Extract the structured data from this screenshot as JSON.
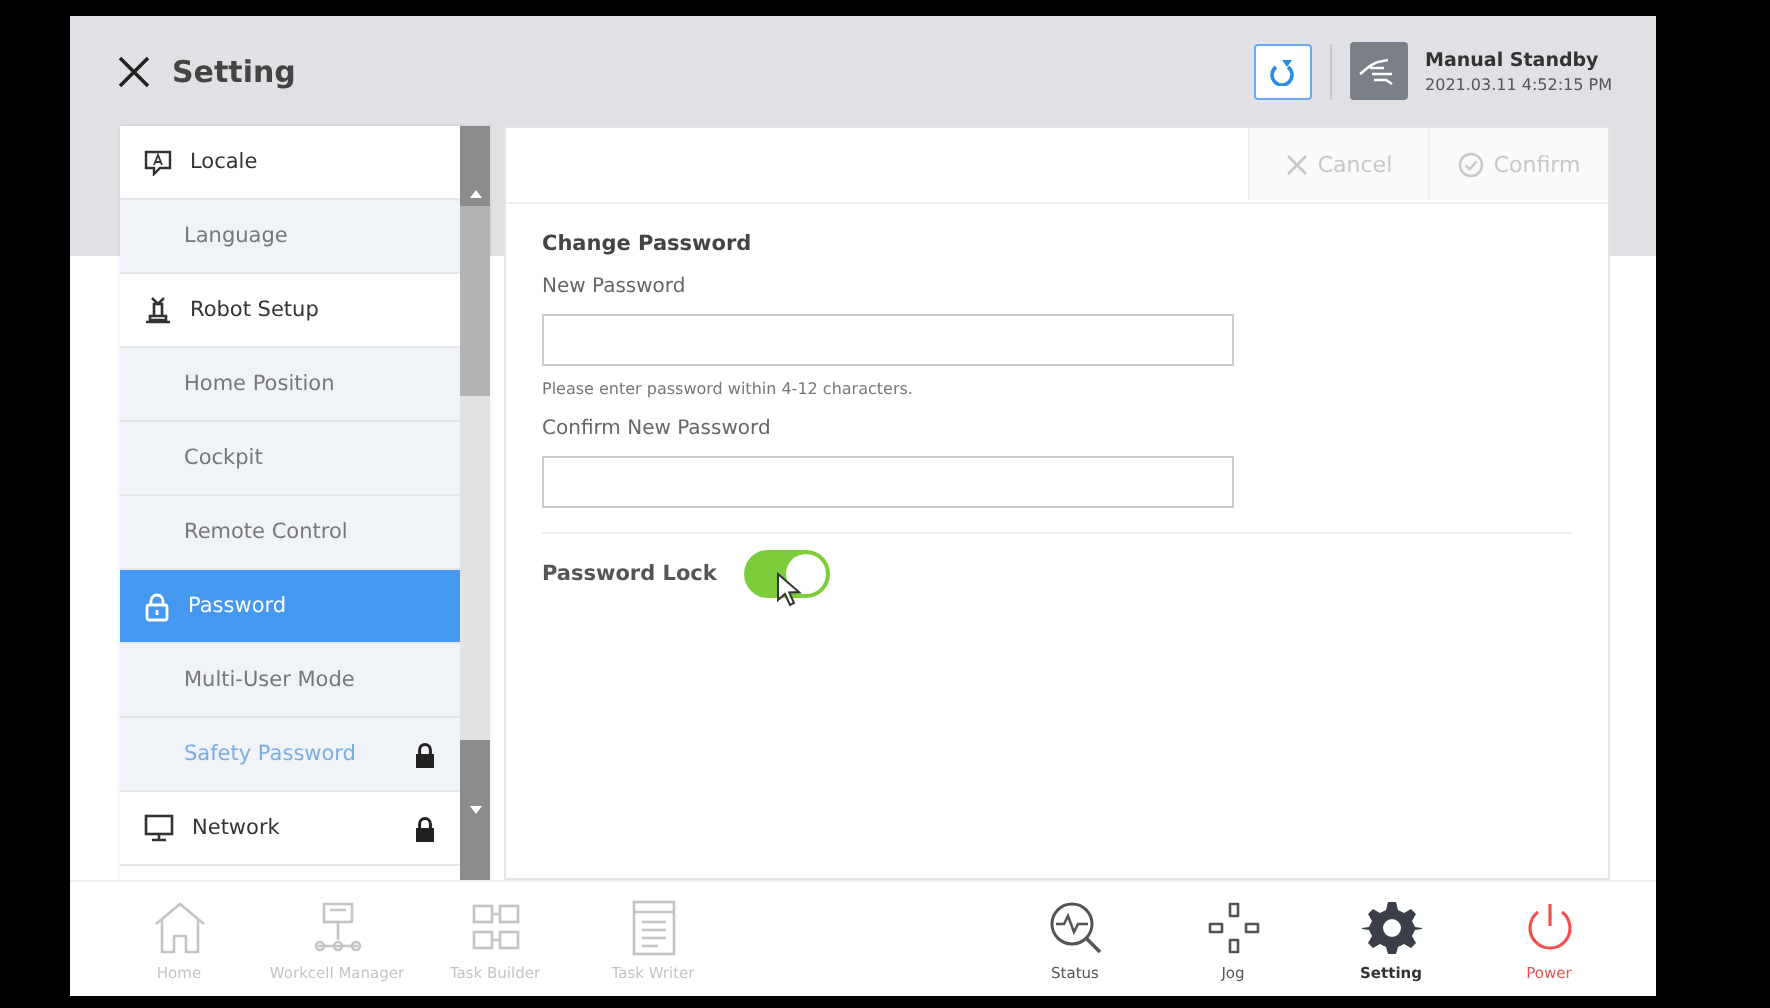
{
  "header": {
    "title": "Setting",
    "mode": "Manual Standby",
    "datetime": "2021.03.11 4:52:15 PM"
  },
  "sidebar": {
    "items": [
      {
        "label": "Locale",
        "kind": "section",
        "selected": false,
        "locked": false,
        "highlighted": false
      },
      {
        "label": "Language",
        "kind": "sub",
        "selected": false,
        "locked": false,
        "highlighted": false
      },
      {
        "label": "Robot Setup",
        "kind": "section",
        "selected": false,
        "locked": false,
        "highlighted": false
      },
      {
        "label": "Home Position",
        "kind": "sub",
        "selected": false,
        "locked": false,
        "highlighted": false
      },
      {
        "label": "Cockpit",
        "kind": "sub",
        "selected": false,
        "locked": false,
        "highlighted": false
      },
      {
        "label": "Remote Control",
        "kind": "sub",
        "selected": false,
        "locked": false,
        "highlighted": false
      },
      {
        "label": "Password",
        "kind": "section",
        "selected": true,
        "locked": false,
        "highlighted": false
      },
      {
        "label": "Multi-User Mode",
        "kind": "sub",
        "selected": false,
        "locked": false,
        "highlighted": false
      },
      {
        "label": "Safety Password",
        "kind": "sub",
        "selected": false,
        "locked": true,
        "highlighted": true
      },
      {
        "label": "Network",
        "kind": "section",
        "selected": false,
        "locked": true,
        "highlighted": false
      }
    ]
  },
  "actions": [
    {
      "label": "Cancel",
      "disabled": true
    },
    {
      "label": "Confirm",
      "disabled": true
    }
  ],
  "form": {
    "title": "Change Password",
    "fields": [
      {
        "label": "New Password",
        "hint": "Please enter password within 4-12 characters."
      },
      {
        "label": "Confirm New Password"
      }
    ],
    "toggle": {
      "label": "Password Lock",
      "on": true
    }
  },
  "nav": [
    {
      "label": "Home",
      "disabled": true,
      "selected": false
    },
    {
      "label": "Workcell Manager",
      "disabled": true,
      "selected": false
    },
    {
      "label": "Task Builder",
      "disabled": true,
      "selected": false
    },
    {
      "label": "Task Writer",
      "disabled": true,
      "selected": false
    },
    {
      "label": "Status",
      "disabled": false,
      "selected": false
    },
    {
      "label": "Jog",
      "disabled": false,
      "selected": false
    },
    {
      "label": "Setting",
      "disabled": false,
      "selected": true
    },
    {
      "label": "Power",
      "kind": "power",
      "disabled": false,
      "selected": false
    }
  ]
}
